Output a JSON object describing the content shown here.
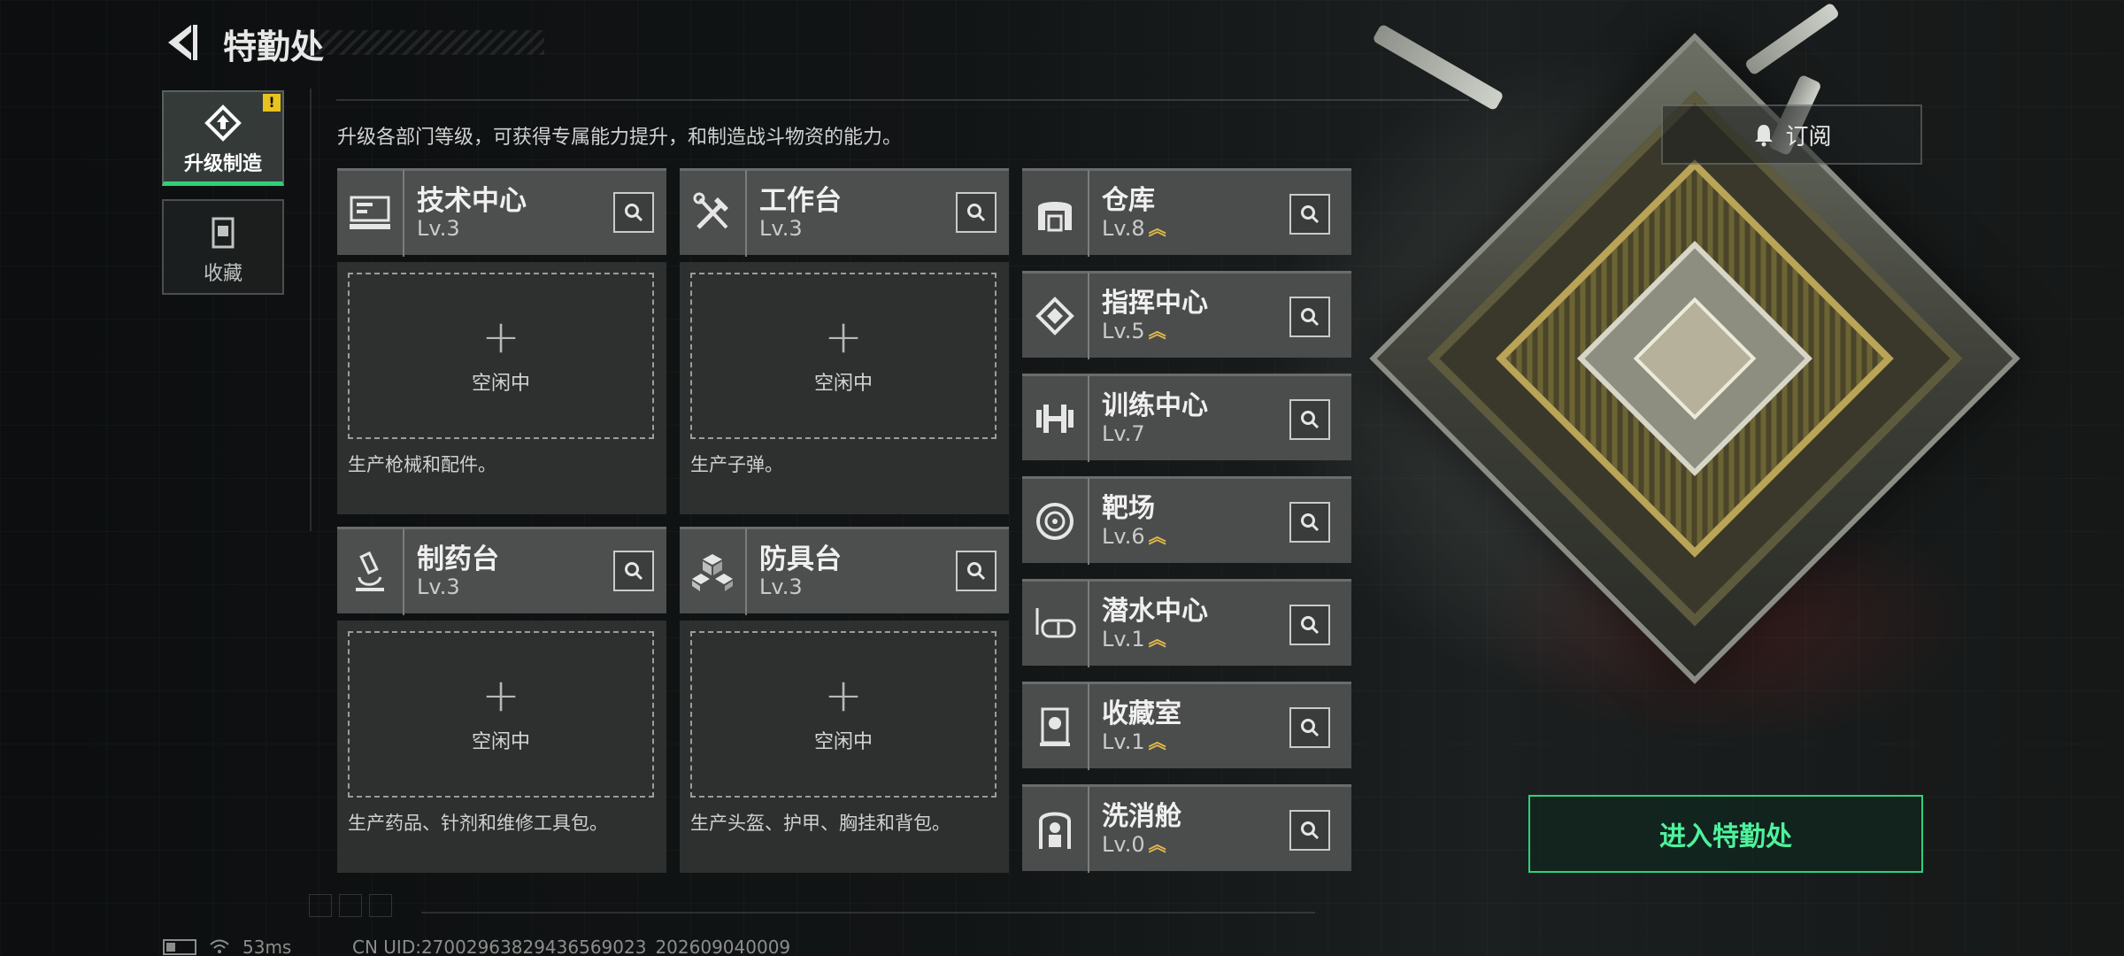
{
  "header": {
    "title": "特勤处"
  },
  "nav": {
    "upgrade_label": "升级制造",
    "upgrade_badge": "!",
    "collect_label": "收藏"
  },
  "subtitle": "升级各部门等级，可获得专属能力提升，和制造战斗物资的能力。",
  "subscribe_label": "订阅",
  "cards": [
    {
      "name": "技术中心",
      "level": "Lv.3",
      "idle": "空闲中",
      "desc": "生产枪械和配件。",
      "icon": "computer-icon"
    },
    {
      "name": "工作台",
      "level": "Lv.3",
      "idle": "空闲中",
      "desc": "生产子弹。",
      "icon": "tools-icon"
    },
    {
      "name": "制药台",
      "level": "Lv.3",
      "idle": "空闲中",
      "desc": "生产药品、针剂和维修工具包。",
      "icon": "microscope-icon"
    },
    {
      "name": "防具台",
      "level": "Lv.3",
      "idle": "空闲中",
      "desc": "生产头盔、护甲、胸挂和背包。",
      "icon": "armor-cubes-icon"
    }
  ],
  "items": [
    {
      "name": "仓库",
      "level": "Lv.8",
      "upgradable": true,
      "icon": "warehouse-icon"
    },
    {
      "name": "指挥中心",
      "level": "Lv.5",
      "upgradable": true,
      "icon": "chip-icon"
    },
    {
      "name": "训练中心",
      "level": "Lv.7",
      "upgradable": false,
      "icon": "dumbbell-icon"
    },
    {
      "name": "靶场",
      "level": "Lv.6",
      "upgradable": true,
      "icon": "target-icon"
    },
    {
      "name": "潜水中心",
      "level": "Lv.1",
      "upgradable": true,
      "icon": "diving-mask-icon"
    },
    {
      "name": "收藏室",
      "level": "Lv.1",
      "upgradable": true,
      "icon": "display-case-icon"
    },
    {
      "name": "洗消舱",
      "level": "Lv.0",
      "upgradable": true,
      "icon": "decontamination-icon"
    }
  ],
  "enter_label": "进入特勤处",
  "status": {
    "ping": "53ms",
    "uid": "CN UID:27002963829436569023_202609040009"
  },
  "colors": {
    "accent": "#2fd07a",
    "upgrade_arrow": "#e3b94a"
  }
}
